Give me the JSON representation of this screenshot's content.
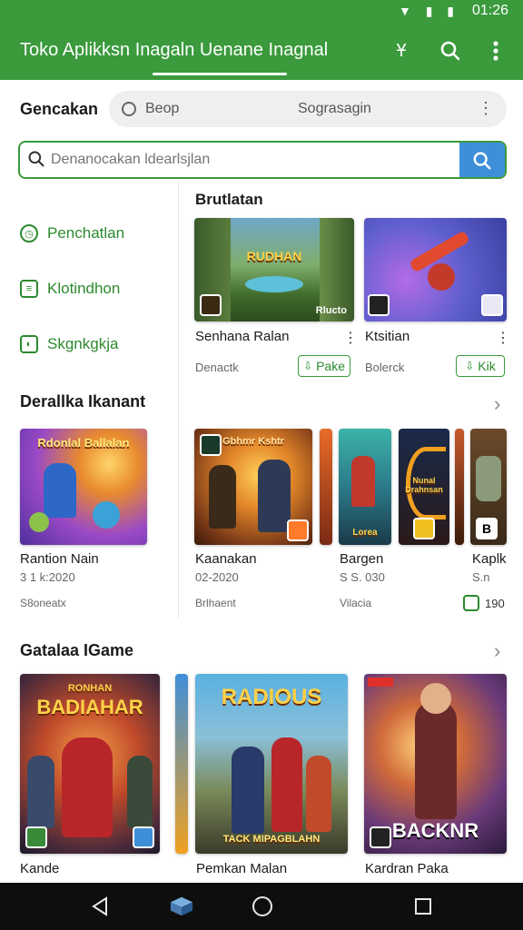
{
  "status": {
    "time": "01:26",
    "icons": "▼ ▮ ▮"
  },
  "appbar": {
    "title": "Toko Aplikksn Inagaln Uenane Inagnal",
    "icon_a": "Ұ"
  },
  "filter": {
    "label": "Gencakan",
    "option1": "Beop",
    "option2": "Sograsagin"
  },
  "search": {
    "placeholder": "Denanocakan ldearlsjlan"
  },
  "sidebar": [
    {
      "label": "Penchatlan",
      "icon": "clock-icon"
    },
    {
      "label": "Klotindhon",
      "icon": "list-icon"
    },
    {
      "label": "Skgnkgkja",
      "icon": "shield-icon"
    }
  ],
  "featured": {
    "heading": "Brutlatan",
    "items": [
      {
        "name": "Senhana Ralan",
        "sub": "Denactk",
        "button": "Pake",
        "art_title": "RUDHAN",
        "art_footer": "Rlucto"
      },
      {
        "name": "Ktsitian",
        "sub": "Bolerck",
        "button": "Kik"
      }
    ]
  },
  "section2": {
    "heading": "Derallka Ikanant",
    "items": [
      {
        "name": "Rantion Nain",
        "date": "3 1 k:2020",
        "meta": "S8oneatx",
        "art_title": "Rdonlal Ballalan"
      },
      {
        "name": "Kaanakan",
        "date": "02-2020",
        "meta": "Brlhaent",
        "art_title": "Gbhmr Kshtr"
      },
      {
        "name": "Bargen",
        "date": "S S. 030",
        "meta": "Vilacia",
        "art_title": "Lorea"
      },
      {
        "name": "",
        "date": "",
        "meta": "",
        "art_title": "Nunal Drahnsan"
      },
      {
        "name": "Kaplk",
        "date": "S.n",
        "meta": "190",
        "art_title": "B"
      }
    ]
  },
  "section3": {
    "heading": "Gatalaa IGame",
    "items": [
      {
        "name": "Kande",
        "art_title": "BADIAHAR",
        "art_top": "RONHAN"
      },
      {
        "name": "Pemkan Malan",
        "art_title": "RADIOUS",
        "art_bottom": "TACK MIPAGBLAHN"
      },
      {
        "name": "Kardran Paka",
        "art_title": "BACKNR"
      }
    ]
  },
  "colors": {
    "primary": "#3a9a3c",
    "search_button": "#3f8fd8"
  }
}
